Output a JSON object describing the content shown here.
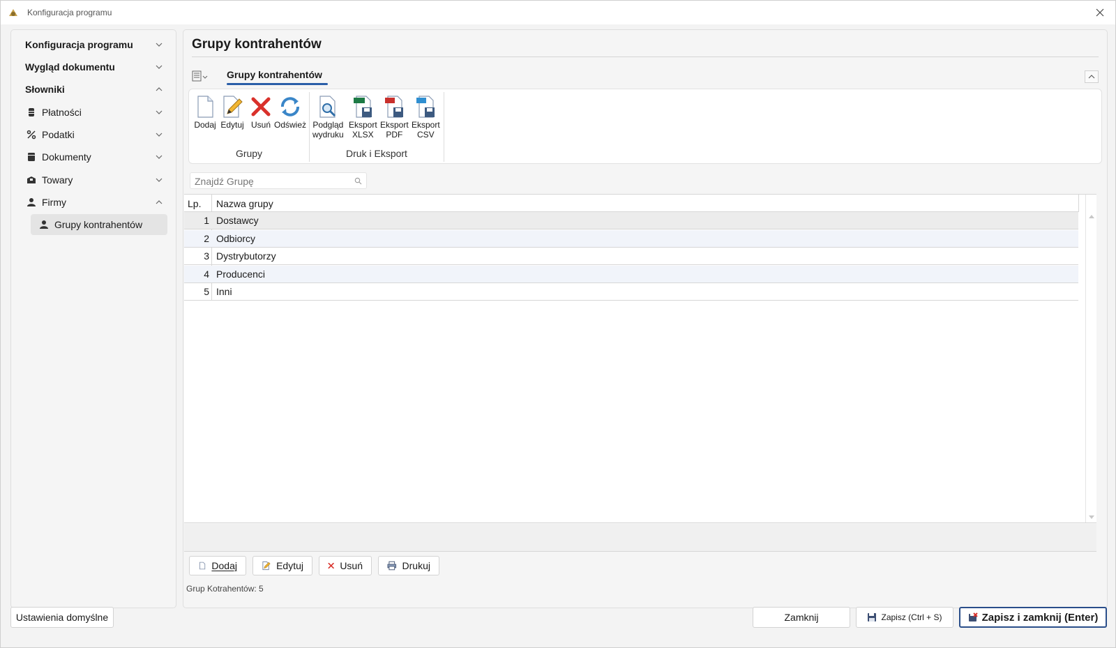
{
  "window": {
    "title": "Konfiguracja programu"
  },
  "sidebar": {
    "items": [
      {
        "label": "Konfiguracja programu",
        "expanded": false
      },
      {
        "label": "Wygląd dokumentu",
        "expanded": false
      },
      {
        "label": "Słowniki",
        "expanded": true
      },
      {
        "label": "Płatności",
        "icon": "payment-icon"
      },
      {
        "label": "Podatki",
        "icon": "percent-icon"
      },
      {
        "label": "Dokumenty",
        "icon": "document-icon"
      },
      {
        "label": "Towary",
        "icon": "box-icon"
      },
      {
        "label": "Firmy",
        "icon": "person-icon"
      },
      {
        "label": "Grupy kontrahentów",
        "icon": "person-icon",
        "active": true
      }
    ]
  },
  "main": {
    "title": "Grupy kontrahentów",
    "ribbon_tab": "Grupy kontrahentów",
    "ribbon": {
      "groups": [
        {
          "label": "Grupy",
          "buttons": [
            "Dodaj",
            "Edytuj",
            "Usuń",
            "Odśwież"
          ]
        },
        {
          "label": "Druk i Eksport",
          "buttons": [
            "Podgląd\nwydruku",
            "Eksport\nXLSX",
            "Eksport\nPDF",
            "Eksport\nCSV"
          ]
        }
      ]
    },
    "search": {
      "placeholder": "Znajdź Grupę",
      "value": ""
    },
    "table": {
      "columns": [
        "Lp.",
        "Nazwa grupy"
      ],
      "rows": [
        {
          "lp": "1",
          "name": "Dostawcy"
        },
        {
          "lp": "2",
          "name": "Odbiorcy"
        },
        {
          "lp": "3",
          "name": "Dystrybutorzy"
        },
        {
          "lp": "4",
          "name": "Producenci"
        },
        {
          "lp": "5",
          "name": "Inni"
        }
      ]
    },
    "bottom_buttons": [
      "Dodaj",
      "Edytuj",
      "Usuń",
      "Drukuj"
    ],
    "count_text": "Grup Kotrahentów: 5"
  },
  "footer": {
    "defaults_button": "Ustawienia domyślne",
    "close_button": "Zamknij",
    "save_button": "Zapisz (Ctrl + S)",
    "save_close_button": "Zapisz i zamknij (Enter)"
  },
  "colors": {
    "accent": "#2a5ea8",
    "delete": "#d9312b",
    "primary_border": "#2a4e8a"
  }
}
